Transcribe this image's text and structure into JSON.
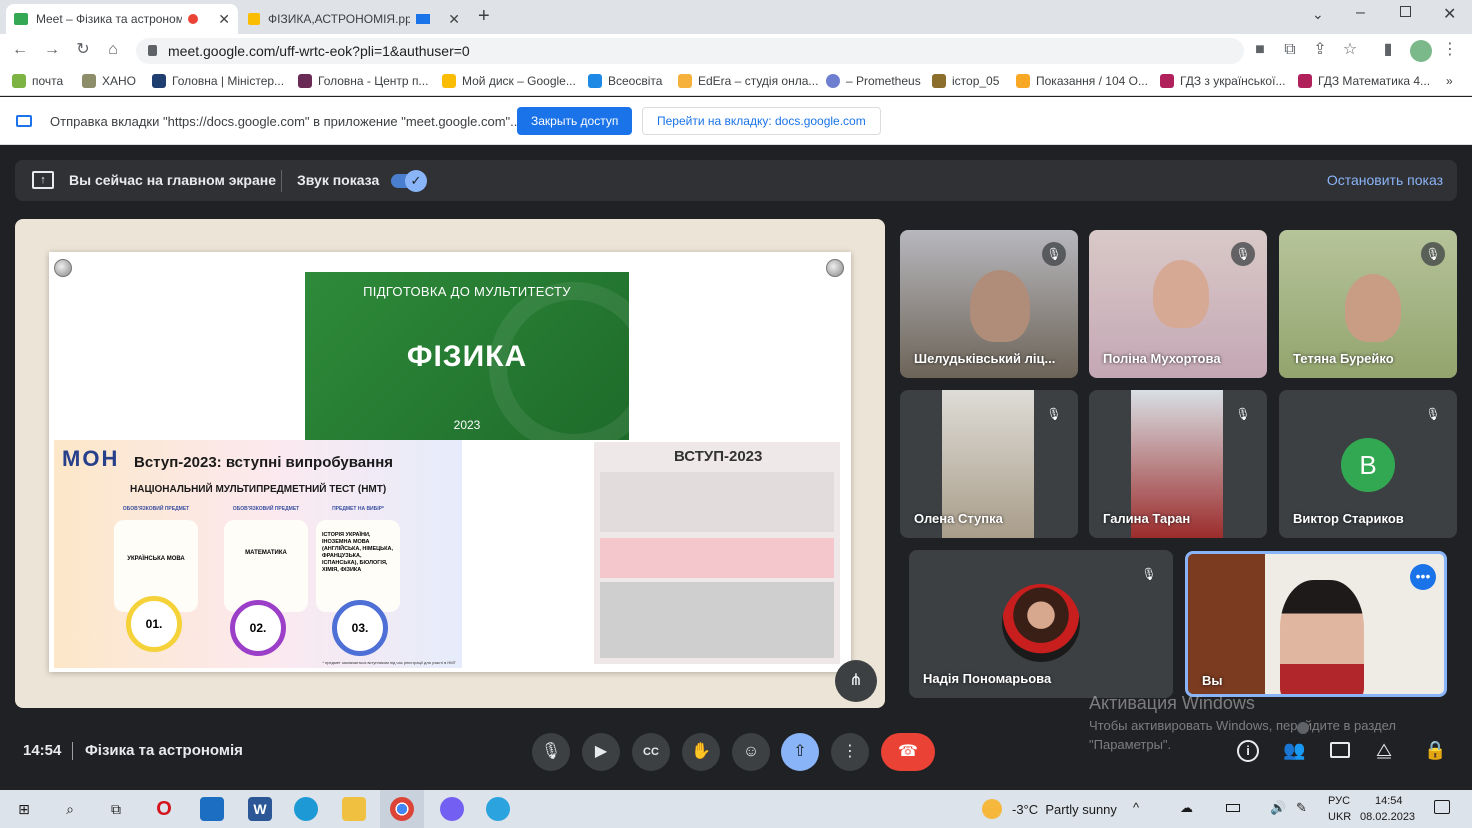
{
  "browser": {
    "tabs": [
      {
        "title": "Meet – Фізика та астрономі"
      },
      {
        "title": "ФІЗИКА,АСТРОНОМІЯ.pptx"
      }
    ],
    "new_tab": "+",
    "url": "meet.google.com/uff-wrtc-eok?pli=1&authuser=0",
    "bookmarks": [
      "почта",
      "ХАНО",
      "Головна | Міністер...",
      "Головна - Центр п...",
      "Мой диск – Google...",
      "Всеосвіта",
      "EdEra – студія онла...",
      "– Prometheus",
      "істор_05",
      "Показання / 104 О...",
      "ГДЗ з української...",
      "ГДЗ Математика 4..."
    ],
    "bookmarks_more": "»",
    "infobar_text": "Отправка вкладки \"https://docs.google.com\" в приложение \"meet.google.com\"...",
    "close_access_label": "Закрыть доступ",
    "goto_tab_label": "Перейти на вкладку: docs.google.com"
  },
  "meet": {
    "present_text": "Вы сейчас на главном экране",
    "sound_label": "Звук показа",
    "stop_label": "Остановить показ",
    "time": "14:54",
    "meeting_title": "Фізика та астрономія",
    "activation_title": "Активация Windows",
    "activation_line1": "Чтобы активировать Windows, перейдите в раздел",
    "activation_line2": "\"Параметры\".",
    "participants": [
      {
        "name": "Шелудьківський ліц...",
        "muted": true
      },
      {
        "name": "Поліна Мухортова",
        "muted": true
      },
      {
        "name": "Тетяна Бурейко",
        "muted": true
      },
      {
        "name": "Олена Ступка",
        "muted": true
      },
      {
        "name": "Галина Таран",
        "muted": true
      },
      {
        "name": "Виктор Стариков",
        "muted": true,
        "initial": "B",
        "avatar_color": "#33a852"
      },
      {
        "name": "Надія Пономарьова",
        "muted": true
      },
      {
        "name": "Вы",
        "muted": false
      }
    ]
  },
  "slide": {
    "title_small": "ПІДГОТОВКА ДО МУЛЬТИТЕСТУ",
    "title_big": "ФІЗИКА",
    "year": "2023",
    "left_logo": "МОН",
    "left_heading": "Вступ-2023: вступні випробування",
    "left_subheading": "НАЦІОНАЛЬНИЙ МУЛЬТИПРЕДМЕТНИЙ ТЕСТ (НМТ)",
    "cards": [
      {
        "tag": "ОБОВ'ЯЗКОВИЙ ПРЕДМЕТ",
        "text": "УКРАЇНСЬКА МОВА",
        "num": "01."
      },
      {
        "tag": "ОБОВ'ЯЗКОВИЙ ПРЕДМЕТ",
        "text": "МАТЕМАТИКА",
        "num": "02."
      },
      {
        "tag": "ПРЕДМЕТ НА ВИБІР*",
        "text": "ІСТОРІЯ УКРАЇНИ, ІНОЗЕМНА МОВА (АНГЛІЙСЬКА, НІМЕЦЬКА, ФРАНЦУЗЬКА, ІСПАНСЬКА), БІОЛОГІЯ, ХІМІЯ, ФІЗИКА",
        "num": "03."
      }
    ],
    "left_footnote": "* предмет зазначається вступником під час реєстрації для участі в НМТ",
    "right_heading": "ВСТУП-2023"
  },
  "taskbar": {
    "weather": "-3°C  Partly sunny",
    "lang_top": "РУС",
    "lang_bottom": "UKR",
    "clock_time": "14:54",
    "clock_date": "08.02.2023"
  },
  "colors": {
    "meet_bg": "#202124",
    "accent_blue": "#1a73e8",
    "hangup_red": "#ea4335",
    "slide_green": "#2e8b3a"
  }
}
